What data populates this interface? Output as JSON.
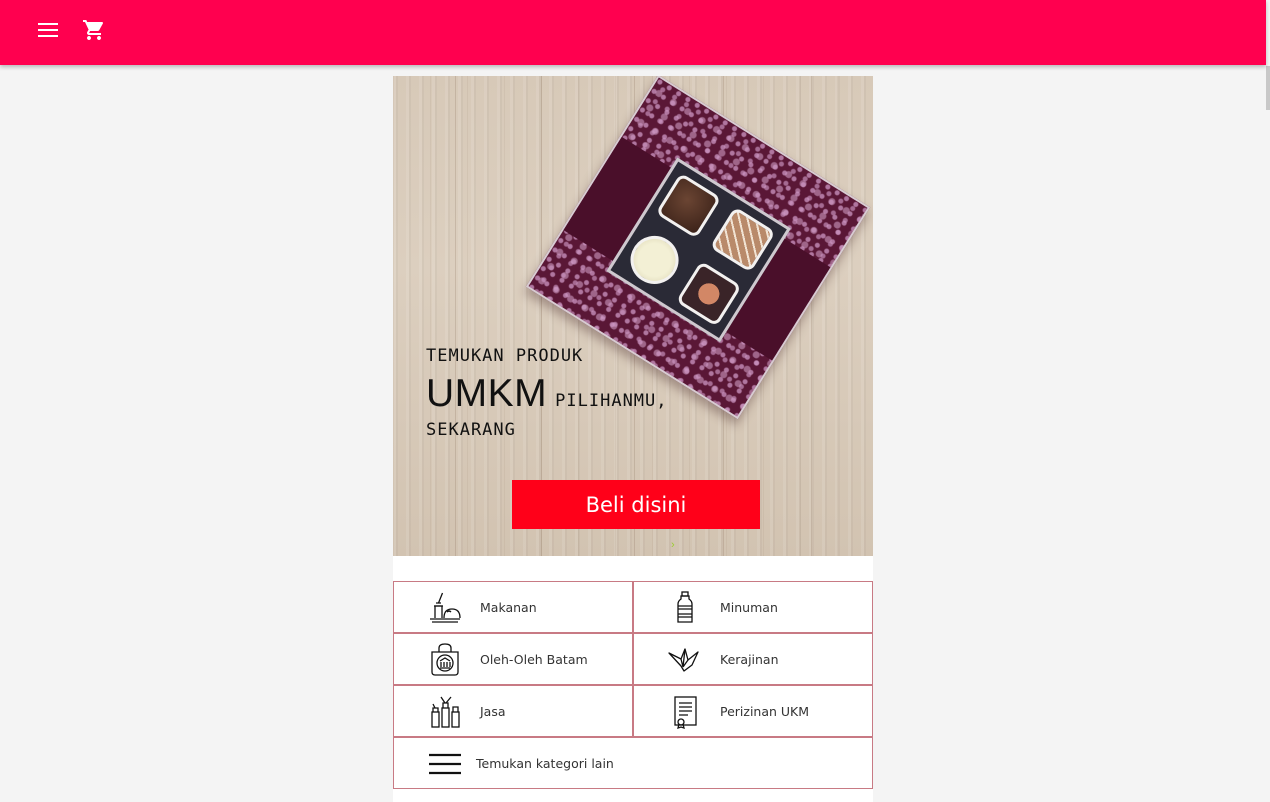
{
  "topbar": {
    "color": "#ff004f",
    "menu_icon": "menu-icon",
    "cart_icon": "shopping-cart-icon"
  },
  "hero": {
    "line1": "TEMUKAN PRODUK",
    "big": "UMKM",
    "line2_rest": "PILIHANMU,",
    "line3": "SEKARANG",
    "button_label": "Beli disini",
    "button_color": "#ff0019",
    "carousel_indicator": "›"
  },
  "categories": [
    {
      "label": "Makanan",
      "icon": "food-tray-icon"
    },
    {
      "label": "Minuman",
      "icon": "bottle-icon"
    },
    {
      "label": "Oleh-Oleh Batam",
      "icon": "gift-bag-icon"
    },
    {
      "label": "Kerajinan",
      "icon": "origami-bird-icon"
    },
    {
      "label": "Jasa",
      "icon": "service-tools-icon"
    },
    {
      "label": "Perizinan UKM",
      "icon": "certificate-icon"
    },
    {
      "label": "Temukan kategori lain",
      "icon": "hamburger-icon"
    }
  ],
  "category_border_color": "#c87a84"
}
